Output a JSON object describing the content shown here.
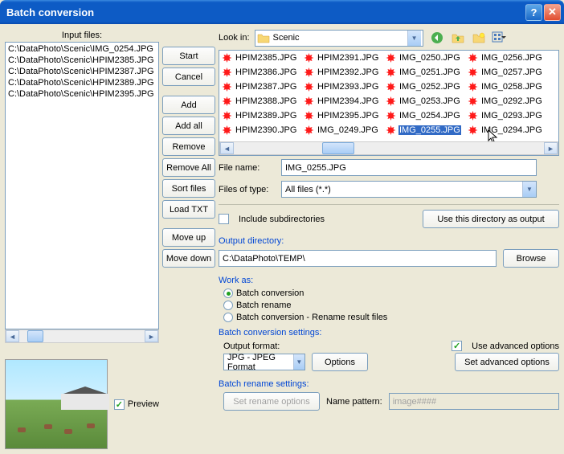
{
  "titlebar": {
    "title": "Batch conversion"
  },
  "input": {
    "label": "Input files:",
    "files": [
      "C:\\DataPhoto\\Scenic\\IMG_0254.JPG",
      "C:\\DataPhoto\\Scenic\\HPIM2385.JPG",
      "C:\\DataPhoto\\Scenic\\HPIM2387.JPG",
      "C:\\DataPhoto\\Scenic\\HPIM2389.JPG",
      "C:\\DataPhoto\\Scenic\\HPIM2395.JPG"
    ]
  },
  "buttons": {
    "start": "Start",
    "cancel": "Cancel",
    "add": "Add",
    "addall": "Add all",
    "remove": "Remove",
    "removeall": "Remove All",
    "sort": "Sort files",
    "loadtxt": "Load TXT",
    "moveup": "Move up",
    "movedown": "Move down"
  },
  "preview": {
    "checked": true,
    "label": "Preview"
  },
  "browser": {
    "lookin_label": "Look in:",
    "folder": "Scenic",
    "files": [
      "HPIM2385.JPG",
      "HPIM2386.JPG",
      "HPIM2387.JPG",
      "HPIM2388.JPG",
      "HPIM2389.JPG",
      "HPIM2390.JPG",
      "HPIM2391.JPG",
      "HPIM2392.JPG",
      "HPIM2393.JPG",
      "HPIM2394.JPG",
      "HPIM2395.JPG",
      "IMG_0249.JPG",
      "IMG_0250.JPG",
      "IMG_0251.JPG",
      "IMG_0252.JPG",
      "IMG_0253.JPG",
      "IMG_0254.JPG",
      "IMG_0255.JPG",
      "IMG_0256.JPG",
      "IMG_0257.JPG",
      "IMG_0258.JPG",
      "IMG_0292.JPG",
      "IMG_0293.JPG",
      "IMG_0294.JPG"
    ],
    "selected": "IMG_0255.JPG",
    "filename_label": "File name:",
    "filename": "IMG_0255.JPG",
    "filetype_label": "Files of type:",
    "filetype": "All files (*.*)",
    "include_sub": "Include subdirectories",
    "include_sub_checked": false,
    "use_dir_btn": "Use this directory as output"
  },
  "output": {
    "label": "Output directory:",
    "path": "C:\\DataPhoto\\TEMP\\",
    "browse": "Browse"
  },
  "workas": {
    "label": "Work as:",
    "options": [
      {
        "label": "Batch conversion",
        "checked": true
      },
      {
        "label": "Batch rename",
        "checked": false
      },
      {
        "label": "Batch conversion - Rename result files",
        "checked": false
      }
    ]
  },
  "bcs": {
    "label": "Batch conversion settings:",
    "format_label": "Output format:",
    "format": "JPG - JPEG Format",
    "options_btn": "Options",
    "adv_check": "Use advanced options",
    "adv_checked": true,
    "adv_btn": "Set advanced options"
  },
  "brs": {
    "label": "Batch rename settings:",
    "btn": "Set rename options",
    "pattern_label": "Name pattern:",
    "pattern": "image####"
  }
}
